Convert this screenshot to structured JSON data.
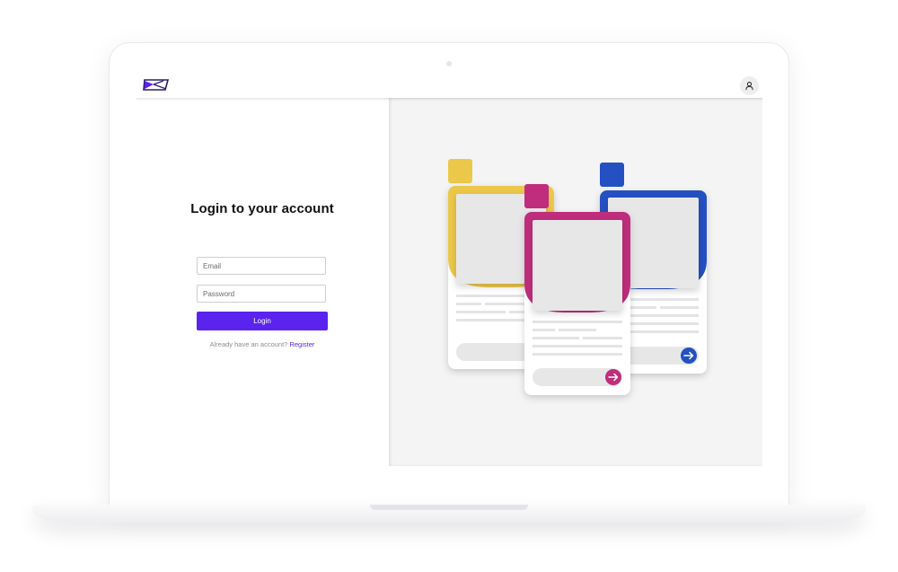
{
  "header": {
    "logo_icon": "logo-icon",
    "user_icon": "user-icon"
  },
  "login": {
    "title": "Login to your account",
    "email_placeholder": "Email",
    "password_placeholder": "Password",
    "button_label": "Login",
    "prompt_text": "Already have an account?",
    "register_link": "Register"
  },
  "illustration": {
    "cards": [
      {
        "color": "#ecc84a",
        "arrow_icon": "arrow-right-icon"
      },
      {
        "color": "#bf2d7c",
        "arrow_icon": "arrow-right-icon"
      },
      {
        "color": "#2450c2",
        "arrow_icon": "arrow-right-icon"
      }
    ]
  },
  "colors": {
    "accent": "#5a23ee",
    "yellow": "#ecc84a",
    "magenta": "#bf2d7c",
    "blue": "#2450c2"
  }
}
